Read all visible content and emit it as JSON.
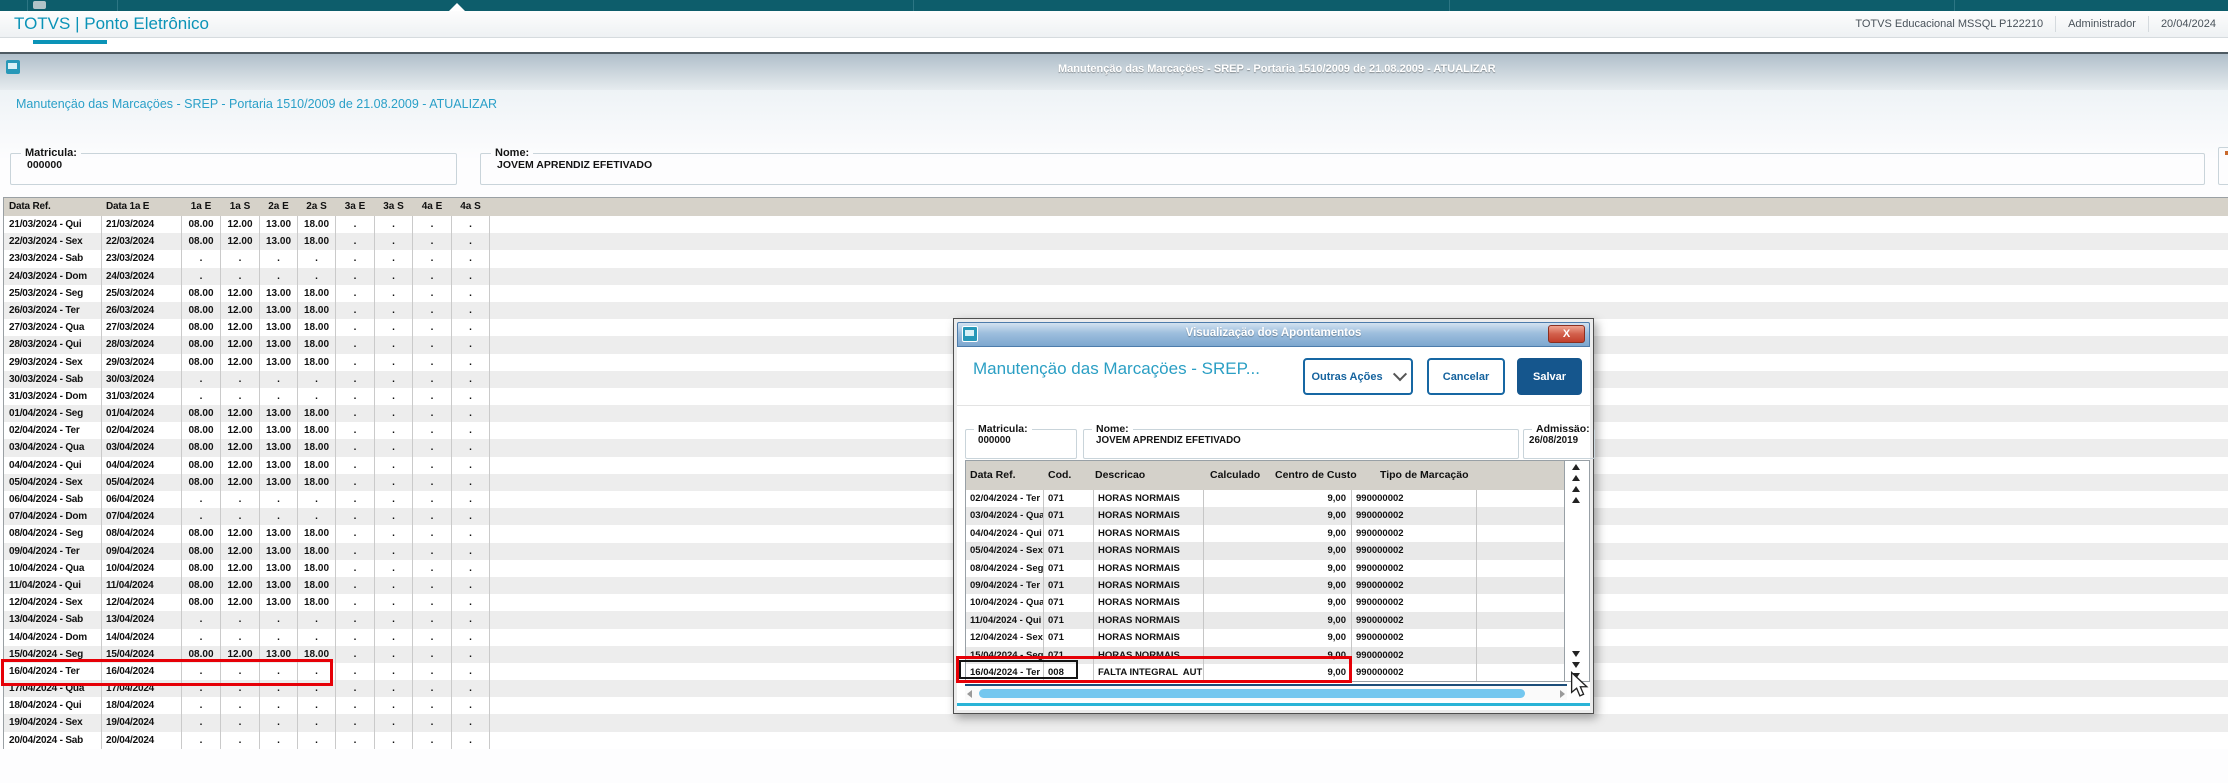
{
  "header": {
    "app_title": "TOTVS | Ponto Eletrônico",
    "environment": "TOTVS Educacional MSSQL P122210",
    "user": "Administrador",
    "date": "20/04/2024"
  },
  "window_bar": {
    "title": "Manutençäo das Marcaçöes - SREP - Portaria 1510/2009 de 21.08.2009 - ATUALIZAR"
  },
  "page": {
    "title": "Manutençäo das Marcaçöes - SREP - Portaria 1510/2009 de 21.08.2009 - ATUALIZAR",
    "matricula_label": "Matricula:",
    "matricula_value": "000000",
    "nome_label": "Nome:",
    "nome_value": "JOVEM APRENDIZ EFETIVADO"
  },
  "main_table": {
    "columns": [
      "Data Ref.",
      "Data 1a E",
      "1a E",
      "1a S",
      "2a E",
      "2a S",
      "3a E",
      "3a S",
      "4a E",
      "4a S"
    ],
    "rows": [
      [
        "21/03/2024 - Qui",
        "21/03/2024",
        "08.00",
        "12.00",
        "13.00",
        "18.00",
        ".",
        ".",
        ".",
        "."
      ],
      [
        "22/03/2024 - Sex",
        "22/03/2024",
        "08.00",
        "12.00",
        "13.00",
        "18.00",
        ".",
        ".",
        ".",
        "."
      ],
      [
        "23/03/2024 - Sab",
        "23/03/2024",
        ".",
        ".",
        ".",
        ".",
        ".",
        ".",
        ".",
        "."
      ],
      [
        "24/03/2024 - Dom",
        "24/03/2024",
        ".",
        ".",
        ".",
        ".",
        ".",
        ".",
        ".",
        "."
      ],
      [
        "25/03/2024 - Seg",
        "25/03/2024",
        "08.00",
        "12.00",
        "13.00",
        "18.00",
        ".",
        ".",
        ".",
        "."
      ],
      [
        "26/03/2024 - Ter",
        "26/03/2024",
        "08.00",
        "12.00",
        "13.00",
        "18.00",
        ".",
        ".",
        ".",
        "."
      ],
      [
        "27/03/2024 - Qua",
        "27/03/2024",
        "08.00",
        "12.00",
        "13.00",
        "18.00",
        ".",
        ".",
        ".",
        "."
      ],
      [
        "28/03/2024 - Qui",
        "28/03/2024",
        "08.00",
        "12.00",
        "13.00",
        "18.00",
        ".",
        ".",
        ".",
        "."
      ],
      [
        "29/03/2024 - Sex",
        "29/03/2024",
        "08.00",
        "12.00",
        "13.00",
        "18.00",
        ".",
        ".",
        ".",
        "."
      ],
      [
        "30/03/2024 - Sab",
        "30/03/2024",
        ".",
        ".",
        ".",
        ".",
        ".",
        ".",
        ".",
        "."
      ],
      [
        "31/03/2024 - Dom",
        "31/03/2024",
        ".",
        ".",
        ".",
        ".",
        ".",
        ".",
        ".",
        "."
      ],
      [
        "01/04/2024 - Seg",
        "01/04/2024",
        "08.00",
        "12.00",
        "13.00",
        "18.00",
        ".",
        ".",
        ".",
        "."
      ],
      [
        "02/04/2024 - Ter",
        "02/04/2024",
        "08.00",
        "12.00",
        "13.00",
        "18.00",
        ".",
        ".",
        ".",
        "."
      ],
      [
        "03/04/2024 - Qua",
        "03/04/2024",
        "08.00",
        "12.00",
        "13.00",
        "18.00",
        ".",
        ".",
        ".",
        "."
      ],
      [
        "04/04/2024 - Qui",
        "04/04/2024",
        "08.00",
        "12.00",
        "13.00",
        "18.00",
        ".",
        ".",
        ".",
        "."
      ],
      [
        "05/04/2024 - Sex",
        "05/04/2024",
        "08.00",
        "12.00",
        "13.00",
        "18.00",
        ".",
        ".",
        ".",
        "."
      ],
      [
        "06/04/2024 - Sab",
        "06/04/2024",
        ".",
        ".",
        ".",
        ".",
        ".",
        ".",
        ".",
        "."
      ],
      [
        "07/04/2024 - Dom",
        "07/04/2024",
        ".",
        ".",
        ".",
        ".",
        ".",
        ".",
        ".",
        "."
      ],
      [
        "08/04/2024 - Seg",
        "08/04/2024",
        "08.00",
        "12.00",
        "13.00",
        "18.00",
        ".",
        ".",
        ".",
        "."
      ],
      [
        "09/04/2024 - Ter",
        "09/04/2024",
        "08.00",
        "12.00",
        "13.00",
        "18.00",
        ".",
        ".",
        ".",
        "."
      ],
      [
        "10/04/2024 - Qua",
        "10/04/2024",
        "08.00",
        "12.00",
        "13.00",
        "18.00",
        ".",
        ".",
        ".",
        "."
      ],
      [
        "11/04/2024 - Qui",
        "11/04/2024",
        "08.00",
        "12.00",
        "13.00",
        "18.00",
        ".",
        ".",
        ".",
        "."
      ],
      [
        "12/04/2024 - Sex",
        "12/04/2024",
        "08.00",
        "12.00",
        "13.00",
        "18.00",
        ".",
        ".",
        ".",
        "."
      ],
      [
        "13/04/2024 - Sab",
        "13/04/2024",
        ".",
        ".",
        ".",
        ".",
        ".",
        ".",
        ".",
        "."
      ],
      [
        "14/04/2024 - Dom",
        "14/04/2024",
        ".",
        ".",
        ".",
        ".",
        ".",
        ".",
        ".",
        "."
      ],
      [
        "15/04/2024 - Seg",
        "15/04/2024",
        "08.00",
        "12.00",
        "13.00",
        "18.00",
        ".",
        ".",
        ".",
        "."
      ],
      [
        "16/04/2024 - Ter",
        "16/04/2024",
        ".",
        ".",
        ".",
        ".",
        ".",
        ".",
        ".",
        "."
      ],
      [
        "17/04/2024 - Qua",
        "17/04/2024",
        ".",
        ".",
        ".",
        ".",
        ".",
        ".",
        ".",
        "."
      ],
      [
        "18/04/2024 - Qui",
        "18/04/2024",
        ".",
        ".",
        ".",
        ".",
        ".",
        ".",
        ".",
        "."
      ],
      [
        "19/04/2024 - Sex",
        "19/04/2024",
        ".",
        ".",
        ".",
        ".",
        ".",
        ".",
        ".",
        "."
      ],
      [
        "20/04/2024 - Sab",
        "20/04/2024",
        ".",
        ".",
        ".",
        ".",
        ".",
        ".",
        ".",
        "."
      ]
    ],
    "highlighted_row_index": 26
  },
  "modal": {
    "title": "Visualizaçäo dos Apontamentos",
    "close_glyph": "X",
    "heading": "Manutençäo das Marcaçöes - SREP...",
    "buttons": {
      "outras_acoes": "Outras Ações",
      "cancelar": "Cancelar",
      "salvar": "Salvar"
    },
    "fields": {
      "matricula_label": "Matricula:",
      "matricula_value": "000000",
      "nome_label": "Nome:",
      "nome_value": "JOVEM APRENDIZ EFETIVADO",
      "admissao_label": "Admissäo:",
      "admissao_value": "26/08/2019"
    },
    "table": {
      "columns": [
        "Data Ref.",
        "Cod.",
        "Descricao",
        "Calculado",
        "Centro de Custo",
        "Tipo de Marcaçäo"
      ],
      "rows": [
        [
          "02/04/2024 - Ter",
          "071",
          "HORAS NORMAIS",
          "9,00",
          "990000002",
          ""
        ],
        [
          "03/04/2024 - Qua",
          "071",
          "HORAS NORMAIS",
          "9,00",
          "990000002",
          ""
        ],
        [
          "04/04/2024 - Qui",
          "071",
          "HORAS NORMAIS",
          "9,00",
          "990000002",
          ""
        ],
        [
          "05/04/2024 - Sex",
          "071",
          "HORAS NORMAIS",
          "9,00",
          "990000002",
          ""
        ],
        [
          "08/04/2024 - Seg",
          "071",
          "HORAS NORMAIS",
          "9,00",
          "990000002",
          ""
        ],
        [
          "09/04/2024 - Ter",
          "071",
          "HORAS NORMAIS",
          "9,00",
          "990000002",
          ""
        ],
        [
          "10/04/2024 - Qua",
          "071",
          "HORAS NORMAIS",
          "9,00",
          "990000002",
          ""
        ],
        [
          "11/04/2024 - Qui",
          "071",
          "HORAS NORMAIS",
          "9,00",
          "990000002",
          ""
        ],
        [
          "12/04/2024 - Sex",
          "071",
          "HORAS NORMAIS",
          "9,00",
          "990000002",
          ""
        ],
        [
          "15/04/2024 - Seg",
          "071",
          "HORAS NORMAIS",
          "9,00",
          "990000002",
          ""
        ],
        [
          "16/04/2024 - Ter",
          "008",
          "FALTA INTEGRAL  AUT",
          "9,00",
          "990000002",
          ""
        ]
      ],
      "highlighted_row_index": 10
    }
  },
  "icons": {
    "window_icon": "monitor-square",
    "close_icon": "X",
    "chevron_down_icon": "v",
    "tab_indicator_icon": "triangle-up",
    "scroll_up_icon": "triangle-up",
    "scroll_down_icon": "triangle-down",
    "cursor_icon": "arrow-pointer"
  },
  "colors": {
    "accent_teal": "#0b93b7",
    "accent_blue": "#15639e",
    "highlight_red": "#e60007",
    "titlebar_blue": "#7da7cf",
    "scroll_thumb": "#74c7ef",
    "topbar_teal": "#0d5d6b"
  }
}
